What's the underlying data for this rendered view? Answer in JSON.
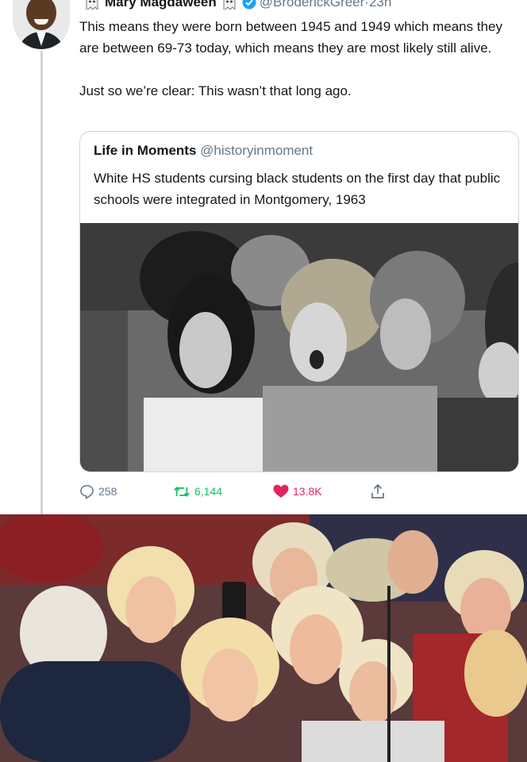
{
  "tweet": {
    "name": "Mary Magdaween",
    "handle": "@BroderickGreer",
    "separator": "·",
    "time": "23h",
    "text_p1": "This means they were born between 1945 and 1949 which means they are between 69-73 today, which means they are most likely still alive.",
    "text_p2": "Just so we’re clear: This wasn’t that long ago.",
    "avatar_icon": "avatar-icon",
    "ghost_icon": "ghost-emoji-icon",
    "verified_icon": "verified-badge-icon",
    "colors": {
      "verified": "#1da1f2",
      "like": "#e0245e",
      "retweet": "#17bf63",
      "meta": "#657786"
    }
  },
  "quoted": {
    "name": "Life in Moments",
    "handle": "@historyinmoment",
    "text": "White HS students cursing black students on the first day that public schools were integrated in Montgomery, 1963"
  },
  "actions": {
    "replies": "258",
    "retweets": "6,144",
    "likes": "13.8K",
    "reply_icon": "reply-icon",
    "retweet_icon": "retweet-icon",
    "like_icon": "heart-icon",
    "share_icon": "share-icon"
  }
}
